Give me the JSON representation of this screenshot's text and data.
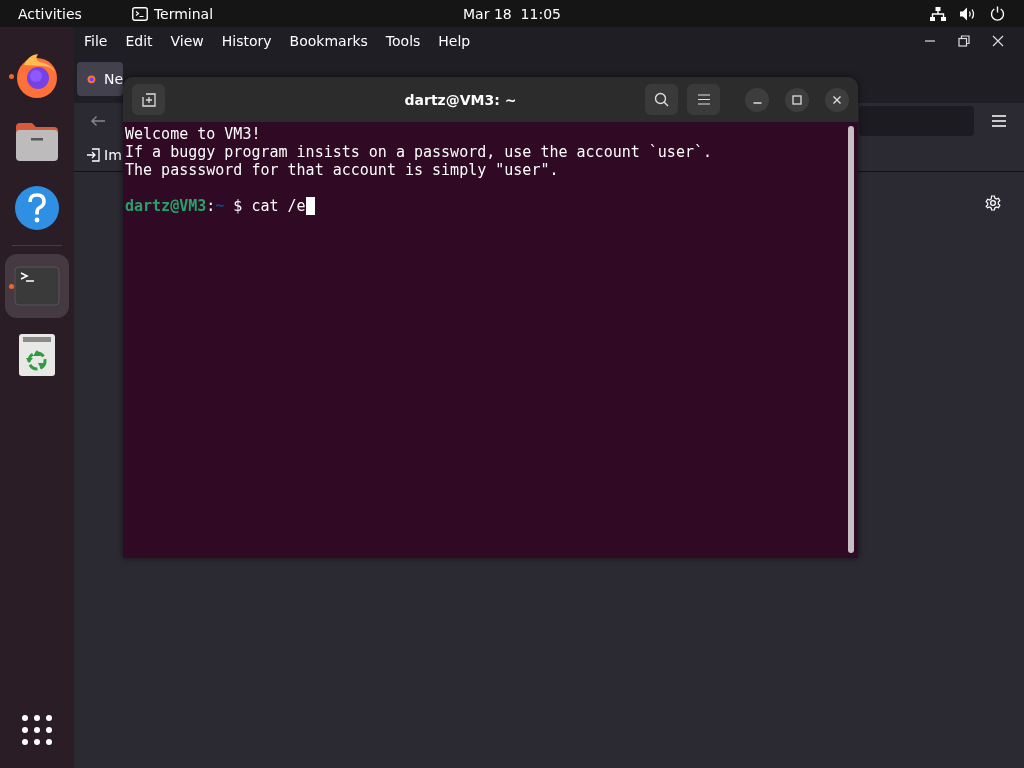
{
  "top_bar": {
    "activities": "Activities",
    "app": "Terminal",
    "clock": "Mar 18  11:05"
  },
  "dock": {
    "items": [
      {
        "kind": "firefox",
        "running": true,
        "selected": false
      },
      {
        "kind": "files",
        "running": false,
        "selected": false
      },
      {
        "kind": "help",
        "running": false,
        "selected": false
      },
      {
        "kind": "terminal",
        "running": true,
        "selected": true
      },
      {
        "kind": "trash",
        "running": false,
        "selected": false
      }
    ]
  },
  "browser": {
    "menu": [
      "File",
      "Edit",
      "View",
      "History",
      "Bookmarks",
      "Tools",
      "Help"
    ],
    "tab": "Ne",
    "bookmark_item": "Im"
  },
  "terminal": {
    "title": "dartz@VM3: ~",
    "lines": [
      "Welcome to VM3!",
      "If a buggy program insists on a password, use the account `user`.",
      "The passsword for that account is simply \"user\"."
    ],
    "prompt": {
      "user_host": "dartz@VM3",
      "separator": ":",
      "path": "~",
      "symbol": "$",
      "command": "cat /e"
    }
  }
}
